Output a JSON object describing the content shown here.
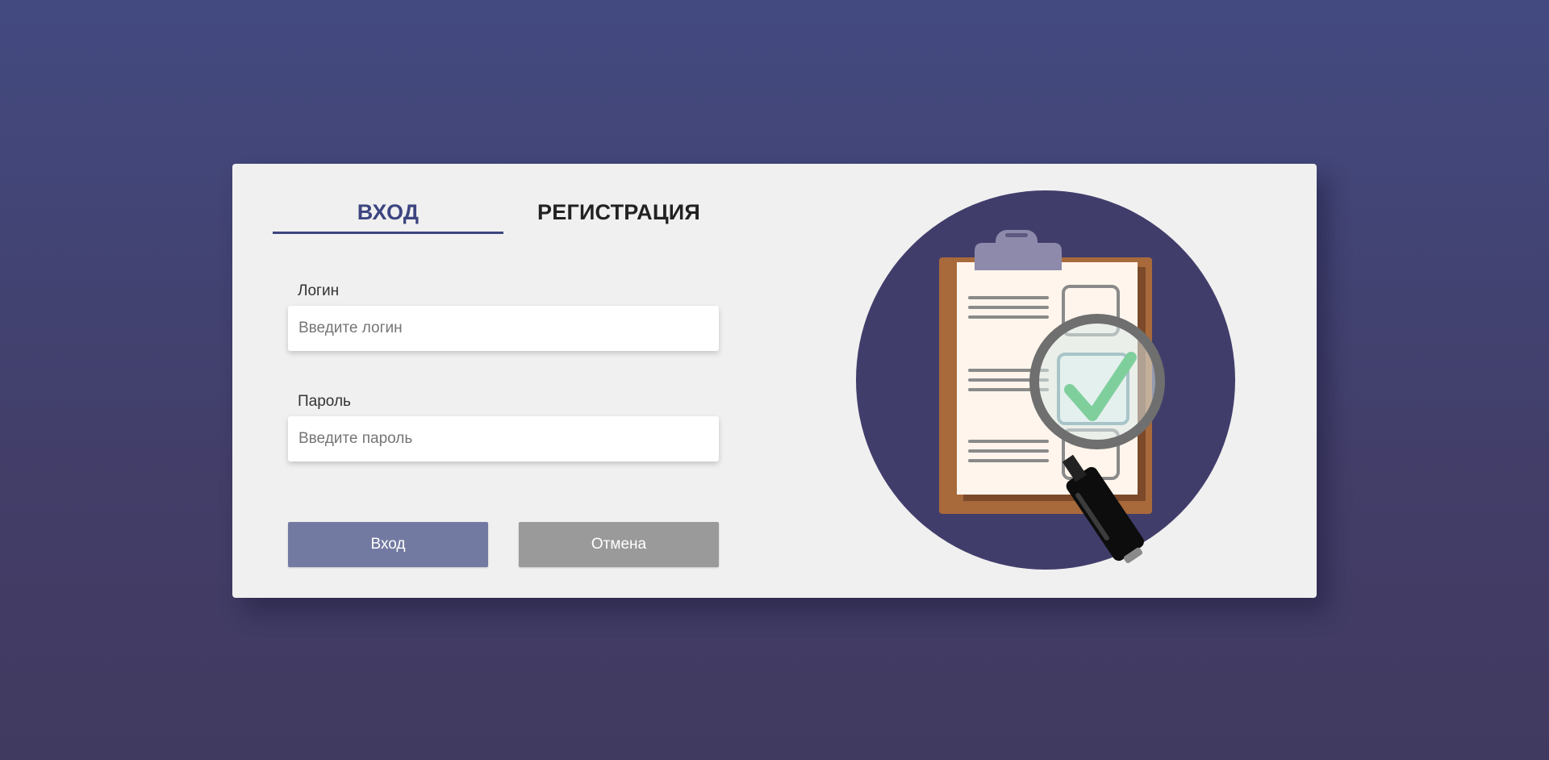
{
  "tabs": {
    "login_label": "ВХОД",
    "register_label": "РЕГИСТРАЦИЯ",
    "active": "login"
  },
  "form": {
    "login": {
      "label": "Логин",
      "placeholder": "Введите логин",
      "value": ""
    },
    "password": {
      "label": "Пароль",
      "placeholder": "Введите пароль",
      "value": ""
    }
  },
  "buttons": {
    "login_label": "Вход",
    "cancel_label": "Отмена"
  },
  "illustration": {
    "icon": "clipboard-magnifier-icon"
  },
  "colors": {
    "accent": "#3d4580",
    "login_button": "#737aa2",
    "cancel_button": "#9a9a9a",
    "circle": "#413d6b",
    "check": "#7fcf9d"
  }
}
